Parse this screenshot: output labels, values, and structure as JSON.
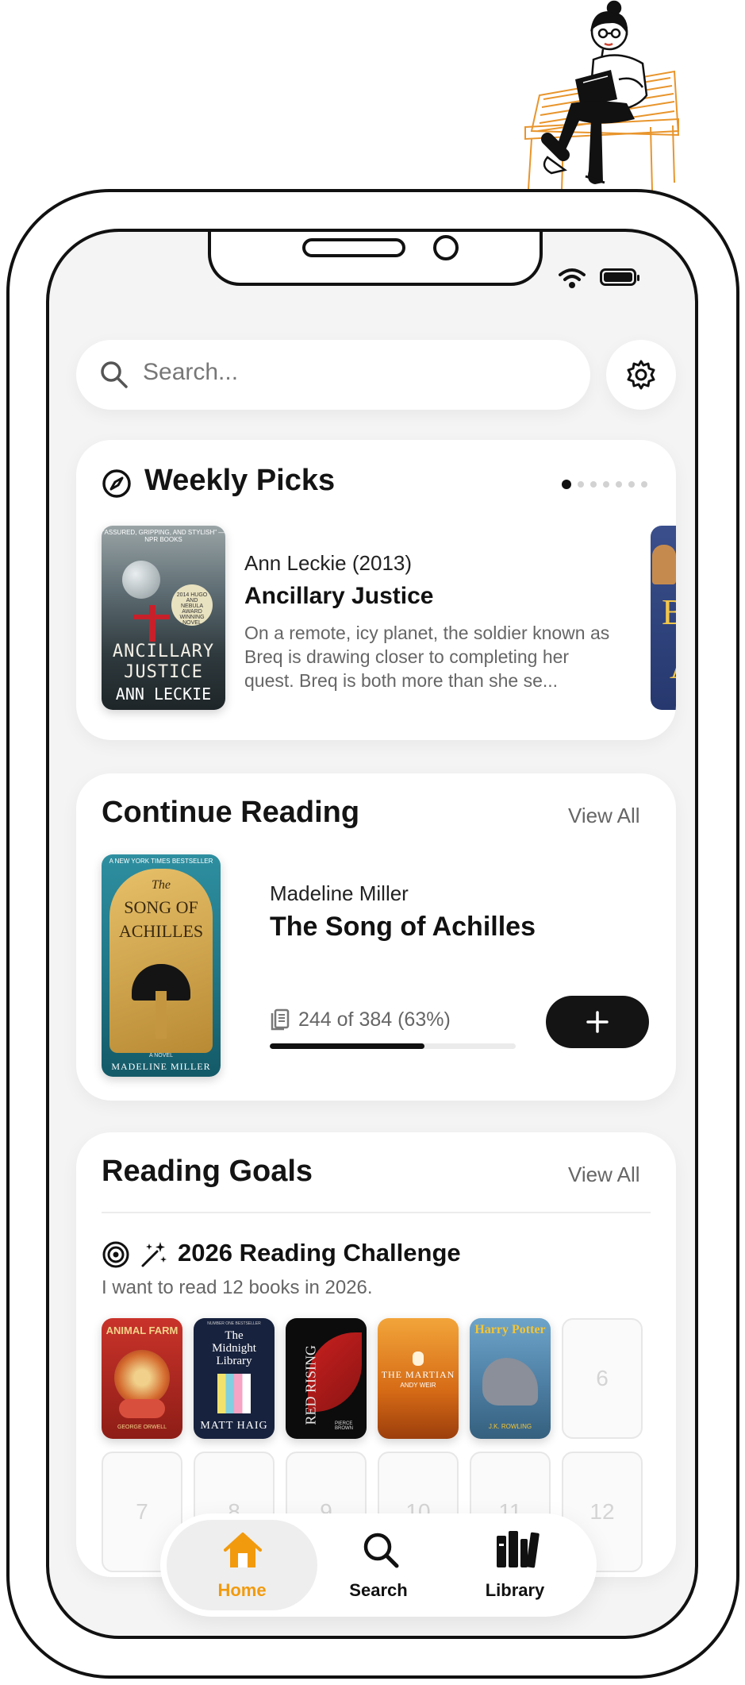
{
  "status_bar": {
    "wifi_icon": "wifi-icon",
    "battery_icon": "battery-icon"
  },
  "search": {
    "placeholder": "Search...",
    "icon": "search-icon",
    "settings_icon": "gear-icon"
  },
  "weekly_picks": {
    "title": "Weekly Picks",
    "icon": "compass-icon",
    "pages": 7,
    "active_page": 1,
    "book": {
      "author_year": "Ann Leckie (2013)",
      "title": "Ancillary Justice",
      "description": "On a remote, icy planet, the soldier known as Breq is drawing closer to completing her quest. Breq is both more than she se...",
      "cover": {
        "tagline": "\"ASSURED, GRIPPING, AND STYLISH\" —NPR BOOKS",
        "badge": "2014 HUGO AND NEBULA AWARD WINNING NOVEL",
        "title_line1": "ANCILLARY",
        "title_line2": "JUSTICE",
        "author": "ANN LECKIE"
      }
    },
    "next_cover": {
      "text_line1": "B",
      "text_line2": "A"
    }
  },
  "continue_reading": {
    "title": "Continue Reading",
    "view_all": "View All",
    "book": {
      "author": "Madeline Miller",
      "title": "The Song of Achilles",
      "progress_text": "244 of 384 (63%)",
      "progress": 0.63,
      "cover": {
        "banner": "A NEW YORK TIMES BESTSELLER",
        "title_the": "The",
        "title_line1": "SONG OF",
        "title_line2": "ACHILLES",
        "novel": "A NOVEL",
        "author": "MADELINE MILLER"
      }
    },
    "add_icon": "plus-icon"
  },
  "reading_goals": {
    "title": "Reading Goals",
    "view_all": "View All",
    "challenge_title": "2026 Reading Challenge",
    "challenge_subtitle": "I want to read 12 books in 2026.",
    "target_icon": "target-icon",
    "sparkle_icon": "magic-wand-icon",
    "books": [
      {
        "title": "ANIMAL FARM",
        "author": "GEORGE ORWELL"
      },
      {
        "pre": "NUMBER ONE BESTSELLER",
        "title_line1": "The",
        "title_line2": "Midnight",
        "title_line3": "Library",
        "author": "MATT HAIG"
      },
      {
        "title": "RED RISING",
        "author": "PIERCE BROWN"
      },
      {
        "title": "THE MARTIAN",
        "author": "ANDY WEIR"
      },
      {
        "title": "Harry Potter",
        "author": "J.K. ROWLING"
      }
    ],
    "empty_slots": [
      "6",
      "7",
      "8",
      "9",
      "10",
      "11",
      "12"
    ]
  },
  "tab_bar": {
    "tabs": [
      {
        "label": "Home",
        "icon": "home-icon",
        "active": true
      },
      {
        "label": "Search",
        "icon": "search-icon",
        "active": false
      },
      {
        "label": "Library",
        "icon": "library-icon",
        "active": false
      }
    ]
  },
  "colors": {
    "accent": "#F29A0D",
    "dark": "#141414",
    "muted": "#666666",
    "background": "#F4F4F4"
  }
}
